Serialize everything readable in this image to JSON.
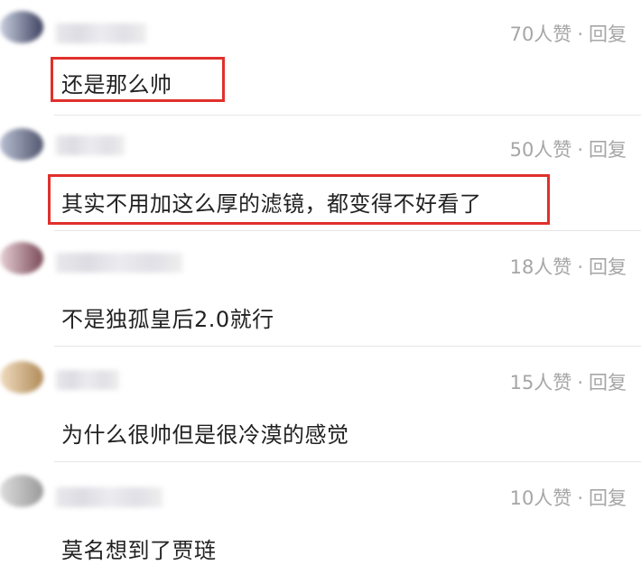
{
  "comments": [
    {
      "likes": "70人赞",
      "separator": "·",
      "reply": "回复",
      "text": "还是那么帅",
      "highlighted": true
    },
    {
      "likes": "50人赞",
      "separator": "·",
      "reply": "回复",
      "text": "其实不用加这么厚的滤镜，都变得不好看了",
      "highlighted": true
    },
    {
      "likes": "18人赞",
      "separator": "·",
      "reply": "回复",
      "text": "不是独孤皇后2.0就行",
      "highlighted": false
    },
    {
      "likes": "15人赞",
      "separator": "·",
      "reply": "回复",
      "text": "为什么很帅但是很冷漠的感觉",
      "highlighted": false
    },
    {
      "likes": "10人赞",
      "separator": "·",
      "reply": "回复",
      "text": "莫名想到了贾琏",
      "highlighted": false
    }
  ],
  "colors": {
    "highlight_border": "#e0302c",
    "meta_text": "#a6a6a6",
    "body_text": "#222222"
  }
}
